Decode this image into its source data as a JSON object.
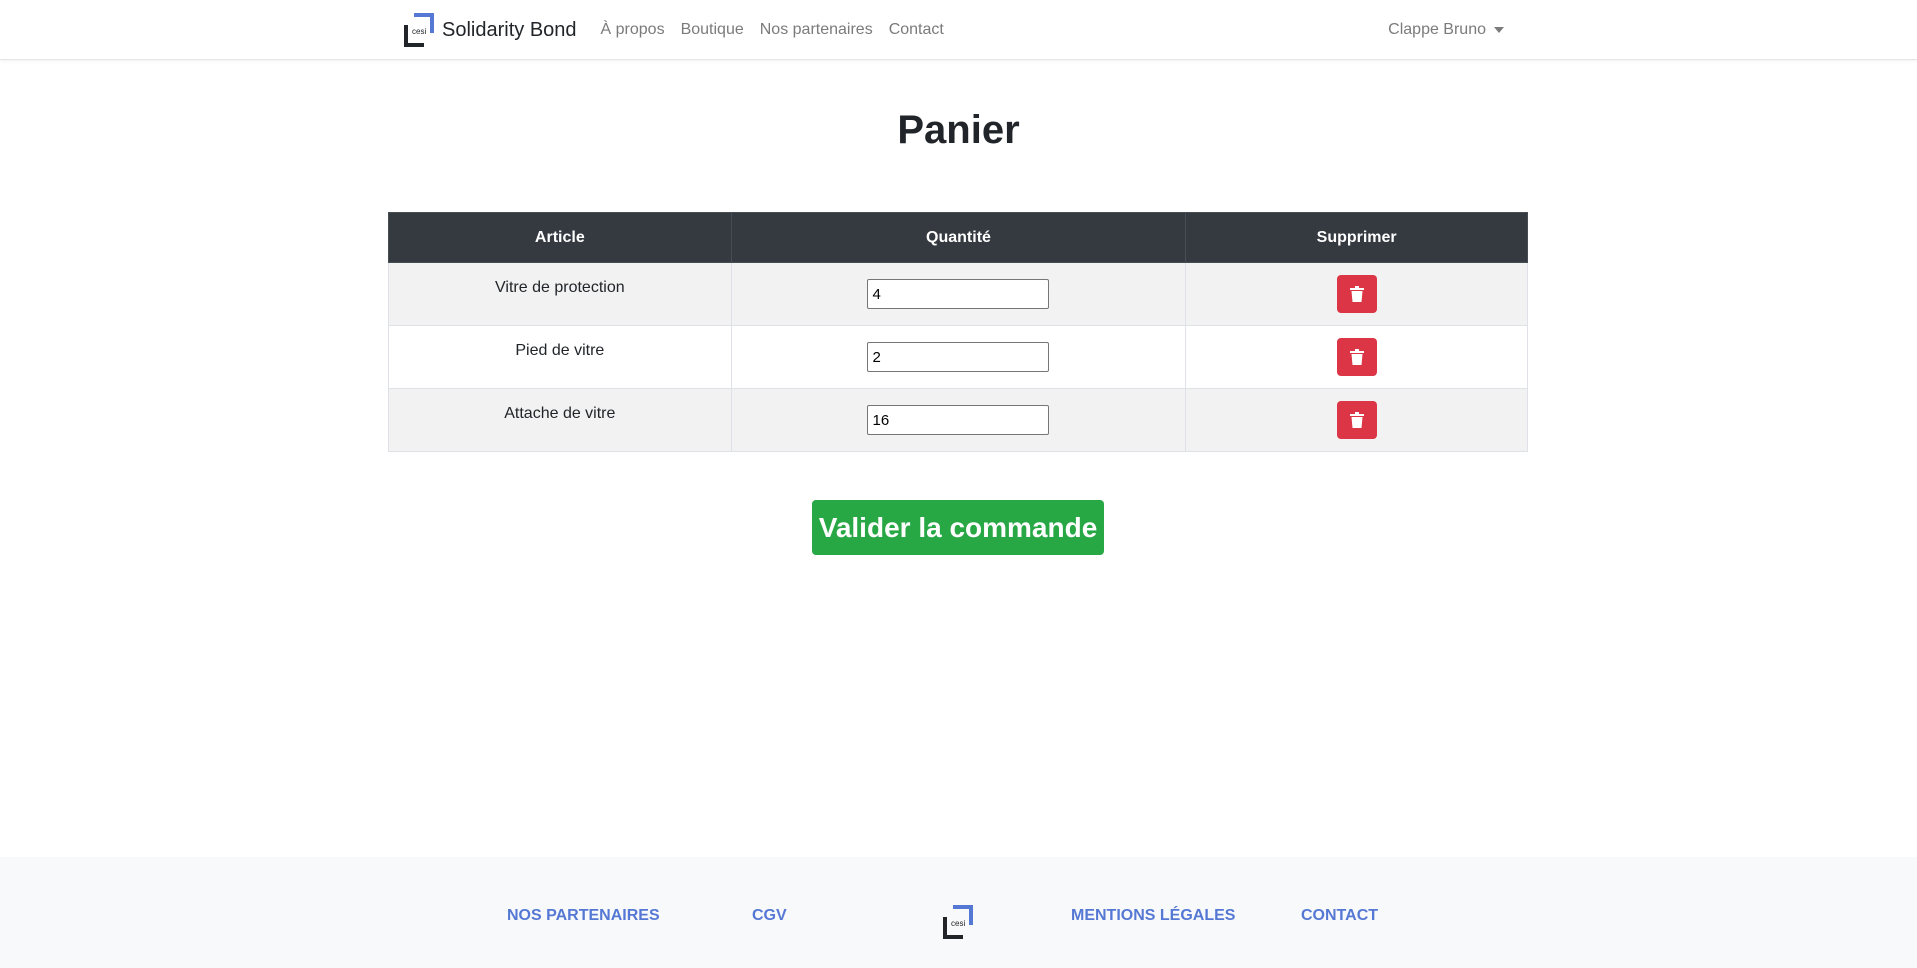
{
  "navbar": {
    "logo_text": "cesi",
    "brand": "Solidarity Bond",
    "links": [
      "À propos",
      "Boutique",
      "Nos partenaires",
      "Contact"
    ],
    "user": "Clappe Bruno"
  },
  "page": {
    "title": "Panier"
  },
  "table": {
    "headers": [
      "Article",
      "Quantité",
      "Supprimer"
    ],
    "rows": [
      {
        "article": "Vitre de protection",
        "quantity": "4"
      },
      {
        "article": "Pied de vitre",
        "quantity": "2"
      },
      {
        "article": "Attache de vitre",
        "quantity": "16"
      }
    ]
  },
  "actions": {
    "validate_label": "Valider la commande"
  },
  "footer": {
    "links": [
      "NOS PARTENAIRES",
      "CGV",
      "MENTIONS LÉGALES",
      "CONTACT"
    ],
    "logo_text": "cesi"
  },
  "colors": {
    "accent_blue": "#5578d4",
    "danger": "#dc3545",
    "success": "#28a745",
    "table_header": "#343a40"
  },
  "icons": {
    "delete": "trash-icon",
    "user_menu": "caret-down-icon",
    "logo": "cesi-logo-icon"
  }
}
